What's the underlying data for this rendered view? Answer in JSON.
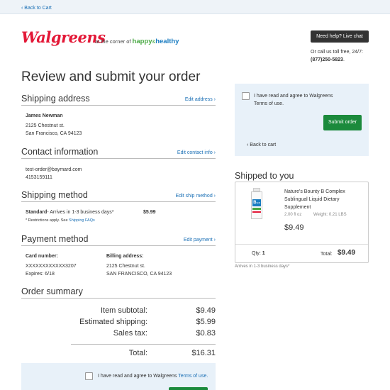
{
  "topbar": {
    "back_to_cart": "‹ Back to Cart"
  },
  "brand": {
    "logo_text": "Walgreens",
    "tagline_prefix": "at the corner of",
    "tagline_happy": "happy",
    "tagline_amp": "&",
    "tagline_healthy": "healthy",
    "brand_red": "#e31837"
  },
  "help": {
    "button_label": "Need help? Live chat",
    "call_text": "Or call us toll free, 24/7:",
    "phone": "(877)250-5823",
    "phone_suffix": "."
  },
  "page_title": "Review and submit your order",
  "shipping_address": {
    "heading": "Shipping address",
    "edit_link": "Edit address ›",
    "name": "James Newman",
    "line1": "2125 Chestnut st.",
    "line2": "San Francisco, CA 94123"
  },
  "contact": {
    "heading": "Contact information",
    "edit_link": "Edit contact info ›",
    "email": "test-order@baymard.com",
    "phone": "4153159111"
  },
  "shipping_method": {
    "heading": "Shipping method",
    "edit_link": "Edit ship method ›",
    "method_name": "Standard",
    "method_desc": "- Arrives in 1-3 business days*",
    "price": "$5.99",
    "note_prefix": "* Restrictions apply. See ",
    "note_link": "Shipping FAQs"
  },
  "payment": {
    "heading": "Payment method",
    "edit_link": "Edit payment ›",
    "card_label": "Card number:",
    "card_number": "XXXXXXXXXXXX3207",
    "expires": "Expires: 6/18",
    "billing_label": "Billing address:",
    "billing_line1": "2125 Chestnut st.",
    "billing_line2": "SAN FRANCISCO, CA 94123"
  },
  "order_summary": {
    "heading": "Order summary",
    "rows": [
      {
        "label": "Item subtotal:",
        "value": "$9.49"
      },
      {
        "label": "Estimated shipping:",
        "value": "$5.99"
      },
      {
        "label": "Sales tax:",
        "value": "$0.83"
      }
    ],
    "total_label": "Total:",
    "total_value": "$16.31"
  },
  "agree": {
    "text": "I have read and agree to Walgreens",
    "link": "Terms of use.",
    "link_right": "Terms of use."
  },
  "right_panel": {
    "submit_label": "Submit order",
    "back_to_cart": "‹ Back to cart"
  },
  "shipped": {
    "heading": "Shipped to you",
    "product_image_label": "B₁₂",
    "product_name_1": "Nature's Bounty B Complex",
    "product_name_2": "Sublingual Liquid Dietary",
    "product_name_3": "Supplement",
    "size": "2.00 fl oz",
    "weight": "Weight: 0.21 LBS",
    "price": "$9.49",
    "qty_label": "Qty:",
    "qty_value": "1",
    "total_label": "Total:",
    "total_value": "$9.49",
    "arrives": "Arrives in 1-3 business days*"
  },
  "colors": {
    "link": "#1a6fb5",
    "submit_green": "#1b8a3c",
    "panel_blue": "#e8f1f9"
  }
}
